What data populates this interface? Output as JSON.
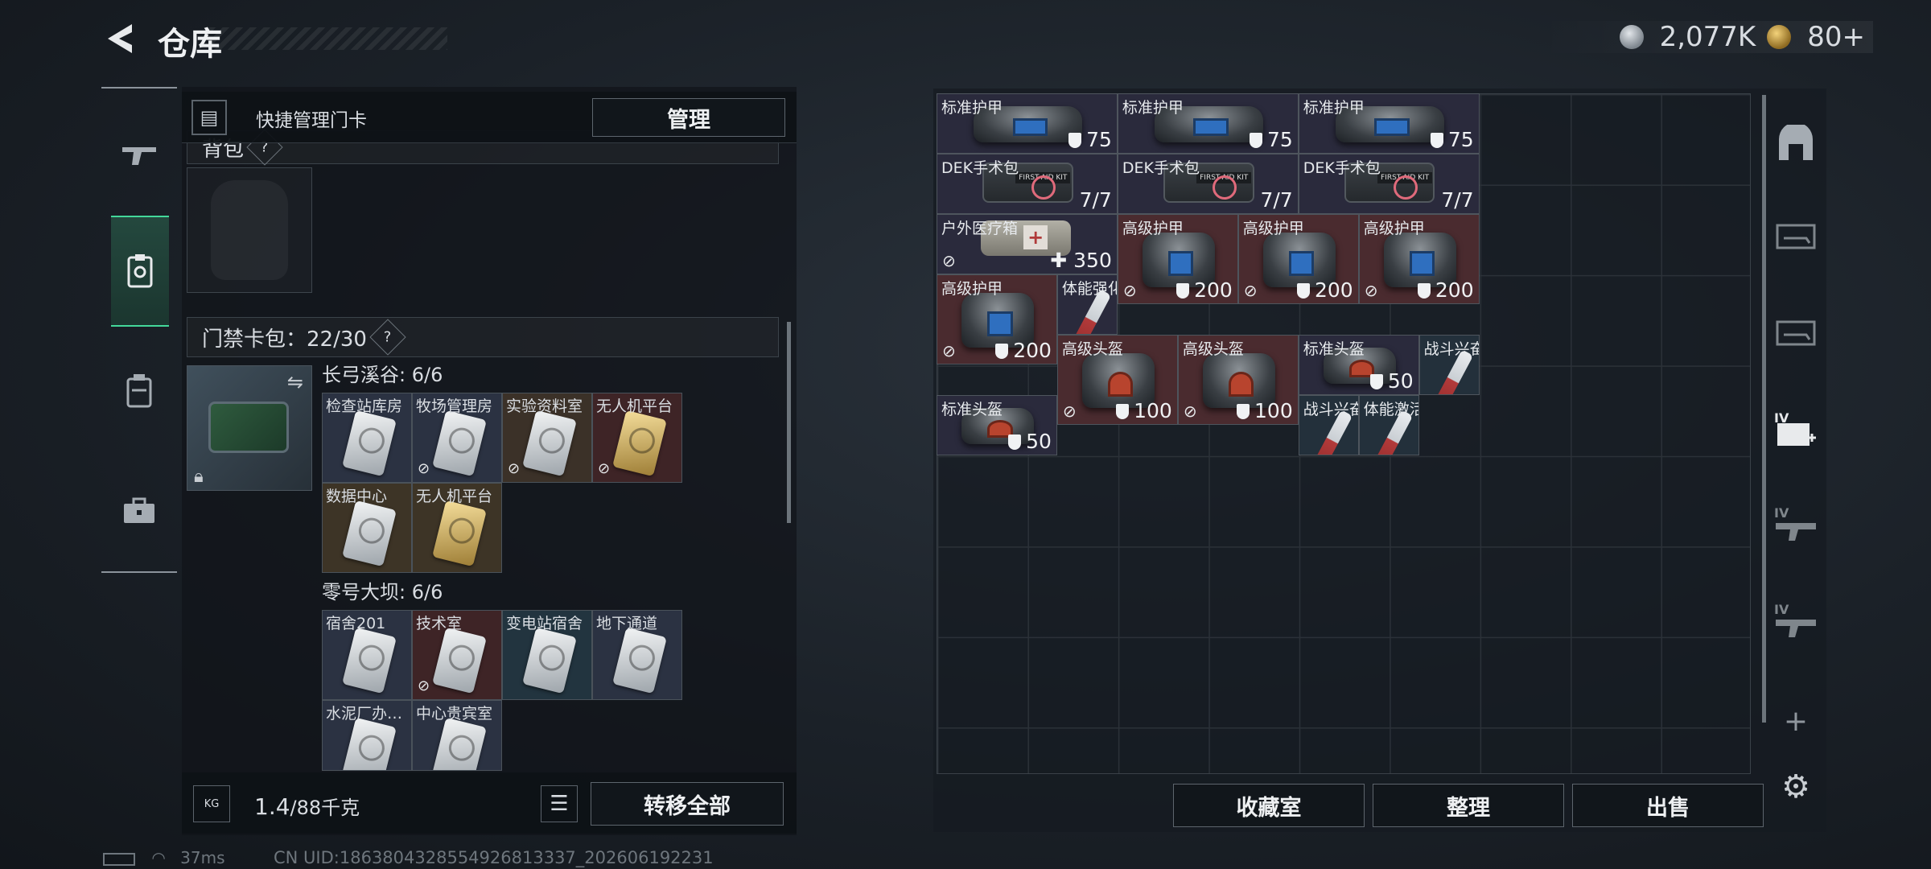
{
  "header": {
    "title": "仓库",
    "currency_silver": "2,077K",
    "currency_gold": "80+"
  },
  "side_nav": {
    "icons": [
      "gun-icon",
      "card-icon",
      "backpack-icon",
      "toolbox-icon"
    ]
  },
  "left": {
    "quick_manage_label": "快捷管理门卡",
    "manage_button": "管理",
    "backpack_label": "背包",
    "cardpack_label": "门禁卡包：22/30",
    "groups": [
      {
        "title": "长弓溪谷: 6/6",
        "cards": [
          {
            "label": "检查站库房",
            "bg": "blue",
            "gold": false,
            "noicon": false
          },
          {
            "label": "牧场管理房",
            "bg": "blue",
            "gold": false,
            "noicon": true
          },
          {
            "label": "实验资料室",
            "bg": "brown",
            "gold": false,
            "noicon": true
          },
          {
            "label": "无人机平台",
            "bg": "red",
            "gold": true,
            "noicon": true
          },
          {
            "label": "数据中心",
            "bg": "tan",
            "gold": false,
            "noicon": false
          },
          {
            "label": "无人机平台",
            "bg": "tan",
            "gold": true,
            "noicon": false
          }
        ]
      },
      {
        "title": "零号大坝: 6/6",
        "cards": [
          {
            "label": "宿舍201",
            "bg": "blue",
            "gold": false,
            "noicon": false
          },
          {
            "label": "技术室",
            "bg": "red",
            "gold": false,
            "noicon": true
          },
          {
            "label": "变电站宿舍",
            "bg": "teal",
            "gold": false,
            "noicon": false
          },
          {
            "label": "地下通道",
            "bg": "blue",
            "gold": false,
            "noicon": false
          },
          {
            "label": "水泥厂办…",
            "bg": "blue",
            "gold": false,
            "noicon": false
          },
          {
            "label": "中心贵宾室",
            "bg": "blue",
            "gold": false,
            "noicon": false
          }
        ]
      }
    ],
    "weight_value": "1.4",
    "weight_total": "/88千克",
    "weight_icon_text": "KG",
    "transfer_all_button": "转移全部"
  },
  "items": [
    {
      "label": "标准护甲",
      "value": "75",
      "kind": "bag",
      "bg": "purple",
      "shield": true,
      "noicon": false
    },
    {
      "label": "标准护甲",
      "value": "75",
      "kind": "bag",
      "bg": "purple",
      "shield": true,
      "noicon": false
    },
    {
      "label": "标准护甲",
      "value": "75",
      "kind": "bag",
      "bg": "purple",
      "shield": true,
      "noicon": false
    },
    {
      "label": "DEK手术包",
      "value": "7/7",
      "kind": "kit",
      "bg": "purple",
      "shield": false,
      "noicon": false
    },
    {
      "label": "DEK手术包",
      "value": "7/7",
      "kind": "kit",
      "bg": "purple",
      "shield": false,
      "noicon": false
    },
    {
      "label": "DEK手术包",
      "value": "7/7",
      "kind": "kit",
      "bg": "purple",
      "shield": false,
      "noicon": false
    },
    {
      "label": "户外医疗箱",
      "value": "✚ 350",
      "kind": "pouch",
      "bg": "purple",
      "shield": false,
      "noicon": true
    },
    {
      "label": "高级护甲",
      "value": "200",
      "kind": "bag",
      "bg": "maroon",
      "shield": true,
      "noicon": true
    },
    {
      "label": "高级护甲",
      "value": "200",
      "kind": "bag",
      "bg": "maroon",
      "shield": true,
      "noicon": true
    },
    {
      "label": "高级护甲",
      "value": "200",
      "kind": "bag",
      "bg": "maroon",
      "shield": true,
      "noicon": true
    },
    {
      "label": "高级护甲",
      "value": "200",
      "kind": "bag",
      "bg": "maroon",
      "shield": true,
      "noicon": true
    },
    {
      "label": "体能强化剂",
      "value": "",
      "kind": "syringe",
      "bg": "purple",
      "shield": false,
      "noicon": false
    },
    {
      "label": "高级头盔",
      "value": "100",
      "kind": "bagred",
      "bg": "maroon",
      "shield": true,
      "noicon": true
    },
    {
      "label": "高级头盔",
      "value": "100",
      "kind": "bagred",
      "bg": "maroon",
      "shield": true,
      "noicon": true
    },
    {
      "label": "标准头盔",
      "value": "50",
      "kind": "bagred",
      "bg": "purple",
      "shield": true,
      "noicon": false
    },
    {
      "label": "战斗兴奋剂",
      "value": "",
      "kind": "syringe",
      "bg": "slate",
      "shield": false,
      "noicon": false
    },
    {
      "label": "标准头盔",
      "value": "50",
      "kind": "bagred",
      "bg": "purple",
      "shield": true,
      "noicon": false
    },
    {
      "label": "战斗兴奋剂",
      "value": "",
      "kind": "syringe",
      "bg": "slate",
      "shield": false,
      "noicon": false
    },
    {
      "label": "体能激活针",
      "value": "",
      "kind": "syringe",
      "bg": "slate",
      "shield": false,
      "noicon": false
    }
  ],
  "bottom_buttons": {
    "collection": "收藏室",
    "sort": "整理",
    "sell": "出售"
  },
  "right_icons": [
    "armor-icon",
    "gun-case-icon-1",
    "gun-case-icon-2",
    "medical-iv-icon",
    "rifle-iv-icon-1",
    "rifle-iv-icon-2",
    "add-icon",
    "gear-icon"
  ],
  "right_icon_labels": {
    "medical": "IV",
    "rifle1": "IV",
    "rifle2": "IV"
  },
  "status": {
    "ping": "37ms",
    "uid": "CN UID:1863804328554926813337_202606192231"
  }
}
